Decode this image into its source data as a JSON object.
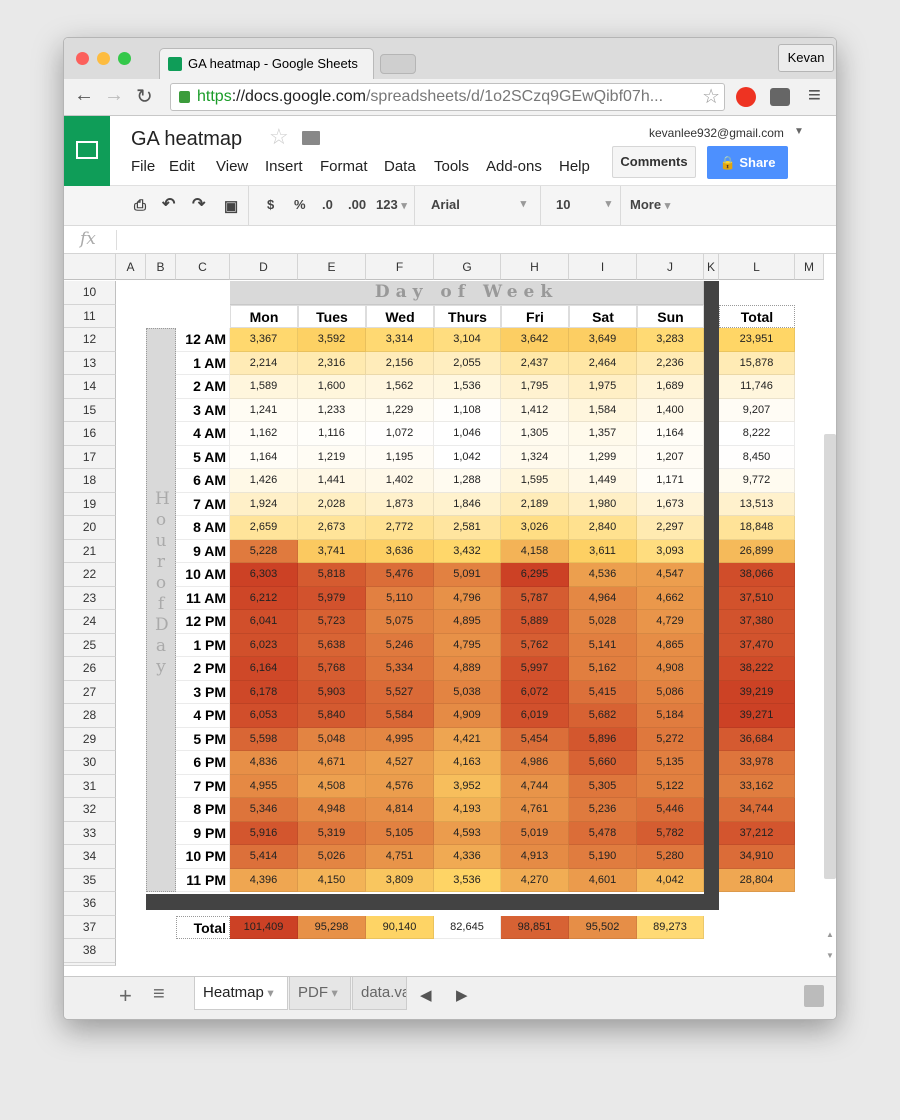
{
  "browser": {
    "tab_title": "GA heatmap - Google Sheets",
    "user": "Kevan",
    "url_scheme": "https",
    "url_host": "://docs.google.com",
    "url_path": "/spreadsheets/d/1o2SCzq9GEwQibf07h..."
  },
  "doc": {
    "title": "GA heatmap",
    "account": "kevanlee932@gmail.com",
    "comments": "Comments",
    "share": "Share",
    "menu": [
      "File",
      "Edit",
      "View",
      "Insert",
      "Format",
      "Data",
      "Tools",
      "Add-ons",
      "Help"
    ]
  },
  "toolbar": {
    "currency": "$",
    "percent": "%",
    "dec_less": ".0",
    "dec_more": ".00",
    "number_format": "123",
    "font": "Arial",
    "size": "10",
    "more": "More"
  },
  "formula": {
    "fx": "fx",
    "value": ""
  },
  "columns": [
    "A",
    "B",
    "C",
    "D",
    "E",
    "F",
    "G",
    "H",
    "I",
    "J",
    "K",
    "L",
    "M"
  ],
  "row_numbers": [
    10,
    11,
    12,
    13,
    14,
    15,
    16,
    17,
    18,
    19,
    20,
    21,
    22,
    23,
    24,
    25,
    26,
    27,
    28,
    29,
    30,
    31,
    32,
    33,
    34,
    35,
    36,
    37,
    38
  ],
  "sheet": {
    "col_group_label": "Day of Week",
    "row_group_label": "Hour of Day",
    "total_label": "Total",
    "days": [
      "Mon",
      "Tues",
      "Wed",
      "Thurs",
      "Fri",
      "Sat",
      "Sun"
    ],
    "hours": [
      "12 AM",
      "1 AM",
      "2 AM",
      "3 AM",
      "4 AM",
      "5 AM",
      "6 AM",
      "7 AM",
      "8 AM",
      "9 AM",
      "10 AM",
      "11 AM",
      "12 PM",
      "1 PM",
      "2 PM",
      "3 PM",
      "4 PM",
      "5 PM",
      "6 PM",
      "7 PM",
      "8 PM",
      "9 PM",
      "10 PM",
      "11 PM"
    ]
  },
  "chart_data": {
    "type": "heatmap",
    "x_categories": [
      "Mon",
      "Tues",
      "Wed",
      "Thurs",
      "Fri",
      "Sat",
      "Sun"
    ],
    "y_categories": [
      "12 AM",
      "1 AM",
      "2 AM",
      "3 AM",
      "4 AM",
      "5 AM",
      "6 AM",
      "7 AM",
      "8 AM",
      "9 AM",
      "10 AM",
      "11 AM",
      "12 PM",
      "1 PM",
      "2 PM",
      "3 PM",
      "4 PM",
      "5 PM",
      "6 PM",
      "7 PM",
      "8 PM",
      "9 PM",
      "10 PM",
      "11 PM"
    ],
    "xlabel": "Day of Week",
    "ylabel": "Hour of Day",
    "color_scale": {
      "low": "#ffffff",
      "mid": "#ffd666",
      "high": "#cc4125"
    },
    "values": [
      [
        3367,
        3592,
        3314,
        3104,
        3642,
        3649,
        3283
      ],
      [
        2214,
        2316,
        2156,
        2055,
        2437,
        2464,
        2236
      ],
      [
        1589,
        1600,
        1562,
        1536,
        1795,
        1975,
        1689
      ],
      [
        1241,
        1233,
        1229,
        1108,
        1412,
        1584,
        1400
      ],
      [
        1162,
        1116,
        1072,
        1046,
        1305,
        1357,
        1164
      ],
      [
        1164,
        1219,
        1195,
        1042,
        1324,
        1299,
        1207
      ],
      [
        1426,
        1441,
        1402,
        1288,
        1595,
        1449,
        1171
      ],
      [
        1924,
        2028,
        1873,
        1846,
        2189,
        1980,
        1673
      ],
      [
        2659,
        2673,
        2772,
        2581,
        3026,
        2840,
        2297
      ],
      [
        5228,
        3741,
        3636,
        3432,
        4158,
        3611,
        3093
      ],
      [
        6303,
        5818,
        5476,
        5091,
        6295,
        4536,
        4547
      ],
      [
        6212,
        5979,
        5110,
        4796,
        5787,
        4964,
        4662
      ],
      [
        6041,
        5723,
        5075,
        4895,
        5889,
        5028,
        4729
      ],
      [
        6023,
        5638,
        5246,
        4795,
        5762,
        5141,
        4865
      ],
      [
        6164,
        5768,
        5334,
        4889,
        5997,
        5162,
        4908
      ],
      [
        6178,
        5903,
        5527,
        5038,
        6072,
        5415,
        5086
      ],
      [
        6053,
        5840,
        5584,
        4909,
        6019,
        5682,
        5184
      ],
      [
        5598,
        5048,
        4995,
        4421,
        5454,
        5896,
        5272
      ],
      [
        4836,
        4671,
        4527,
        4163,
        4986,
        5660,
        5135
      ],
      [
        4955,
        4508,
        4576,
        3952,
        4744,
        5305,
        5122
      ],
      [
        5346,
        4948,
        4814,
        4193,
        4761,
        5236,
        5446
      ],
      [
        5916,
        5319,
        5105,
        4593,
        5019,
        5478,
        5782
      ],
      [
        5414,
        5026,
        4751,
        4336,
        4913,
        5190,
        5280
      ],
      [
        4396,
        4150,
        3809,
        3536,
        4270,
        4601,
        4042
      ]
    ],
    "row_totals": [
      23951,
      15878,
      11746,
      9207,
      8222,
      8450,
      9772,
      13513,
      18848,
      26899,
      38066,
      37510,
      37380,
      37470,
      38222,
      39219,
      39271,
      36684,
      33978,
      33162,
      34744,
      37212,
      34910,
      28804
    ],
    "column_totals": [
      101409,
      95298,
      90140,
      82645,
      98851,
      95502,
      89273
    ]
  },
  "sheet_tabs": [
    {
      "label": "Heatmap",
      "active": true
    },
    {
      "label": "PDF",
      "active": false
    },
    {
      "label": "data.va",
      "active": false
    }
  ]
}
